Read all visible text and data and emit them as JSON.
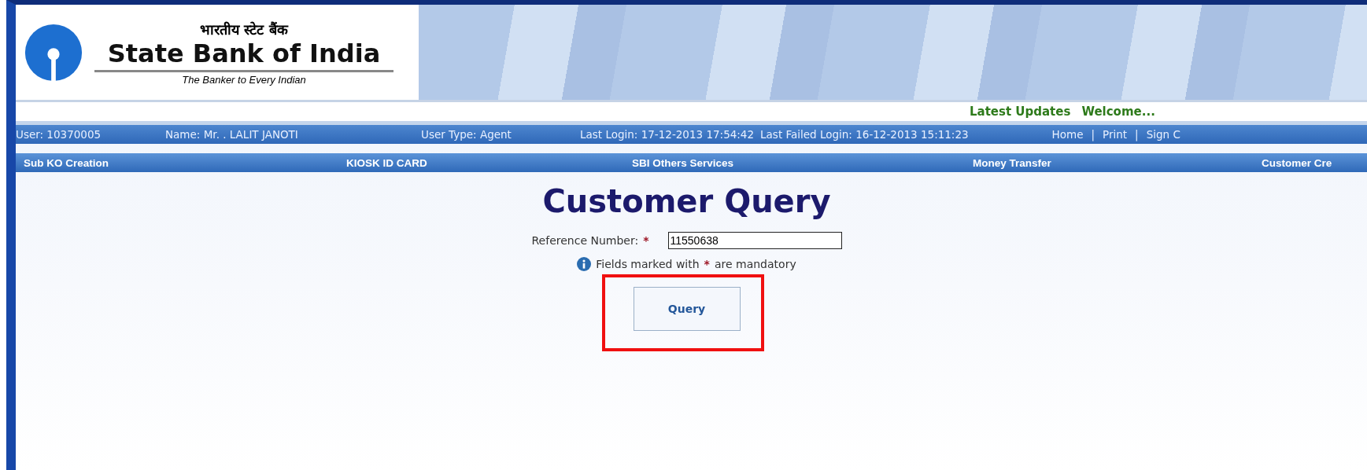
{
  "header": {
    "hindi_name": "भारतीय स्टेट बैंक",
    "bank_name": "State Bank of India",
    "tagline": "The Banker to Every Indian"
  },
  "updates": {
    "label": "Latest Updates",
    "message": "Welcome..."
  },
  "info_bar": {
    "user": "User: 10370005",
    "name": "Name: Mr. . LALIT JANOTI",
    "user_type": "User Type: Agent",
    "last_login": "Last Login: 17-12-2013 17:54:42",
    "last_failed_login": "Last Failed Login: 16-12-2013 15:11:23",
    "links": [
      "Home",
      "Print",
      "Sign C"
    ],
    "separator": "|"
  },
  "menu": [
    "Sub KO Creation",
    "KIOSK ID CARD",
    "SBI Others Services",
    "Money Transfer",
    "Customer Cre"
  ],
  "form": {
    "title": "Customer Query",
    "field_label": "Reference Number:",
    "required_mark": "*",
    "value": "11550638",
    "note_before": "Fields marked with",
    "note_mark": "*",
    "note_after": "are mandatory",
    "button": "Query",
    "button_highlighted": true
  }
}
